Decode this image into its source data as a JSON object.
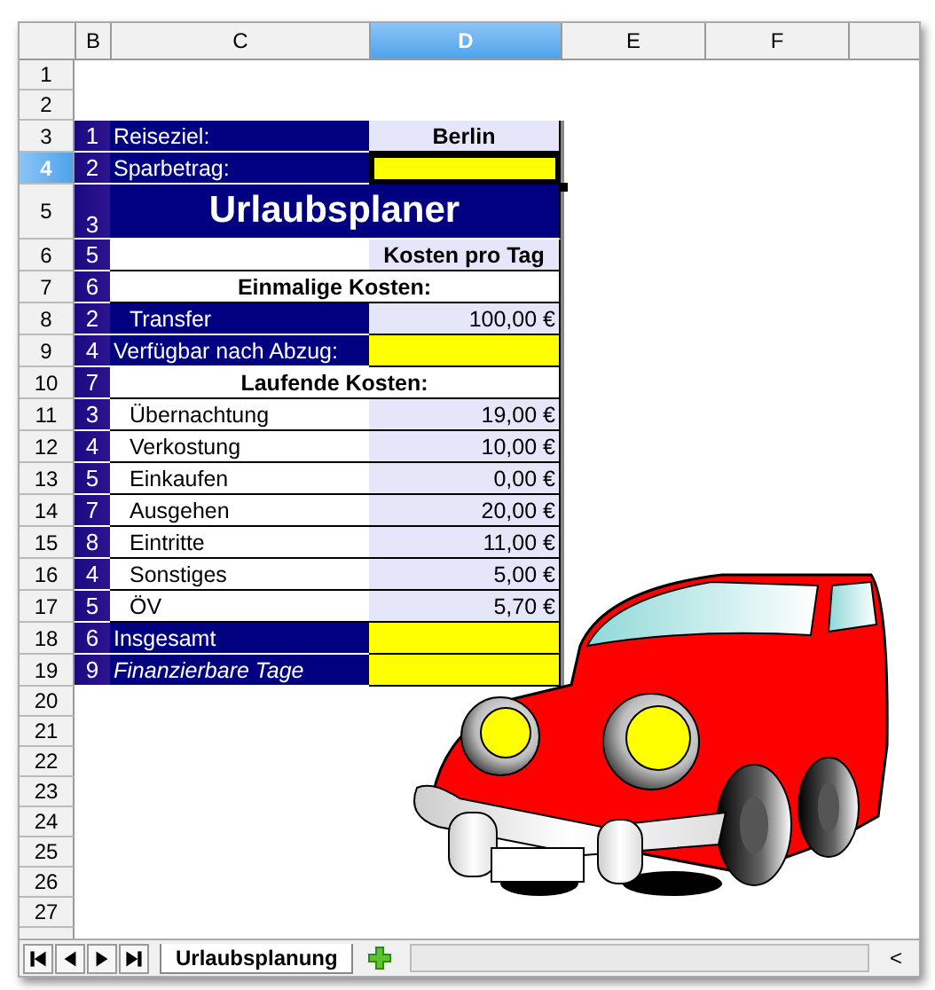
{
  "columns": [
    {
      "label": "B",
      "selected": false
    },
    {
      "label": "C",
      "selected": false
    },
    {
      "label": "D",
      "selected": true
    },
    {
      "label": "E",
      "selected": false
    },
    {
      "label": "F",
      "selected": false
    }
  ],
  "rows": [
    {
      "header": "1",
      "selected": false
    },
    {
      "header": "2",
      "selected": false
    },
    {
      "header": "3",
      "selected": false,
      "kind": "field",
      "num": "1",
      "label": "Reiseziel:",
      "value": "Berlin"
    },
    {
      "header": "4",
      "selected": true,
      "kind": "input",
      "num": "2",
      "label": "Sparbetrag:",
      "cell_selected": true
    },
    {
      "header": "5",
      "selected": false,
      "kind": "title",
      "num": "3",
      "label": "Urlaubsplaner"
    },
    {
      "header": "6",
      "selected": false,
      "kind": "column-head",
      "num": "5",
      "value": "Kosten pro Tag"
    },
    {
      "header": "7",
      "selected": false,
      "kind": "section",
      "num": "6",
      "label": "Einmalige Kosten:"
    },
    {
      "header": "8",
      "selected": false,
      "kind": "fixed-cost",
      "num": "2",
      "label": "Transfer",
      "value": "100,00 €"
    },
    {
      "header": "9",
      "selected": false,
      "kind": "input",
      "num": "4",
      "label": "Verfügbar nach Abzug:",
      "cell_selected": false
    },
    {
      "header": "10",
      "selected": false,
      "kind": "section",
      "num": "7",
      "label": "Laufende Kosten:"
    },
    {
      "header": "11",
      "selected": false,
      "kind": "cost",
      "num": "3",
      "label": "Übernachtung",
      "value": "19,00 €"
    },
    {
      "header": "12",
      "selected": false,
      "kind": "cost",
      "num": "4",
      "label": "Verkostung",
      "value": "10,00 €"
    },
    {
      "header": "13",
      "selected": false,
      "kind": "cost",
      "num": "5",
      "label": "Einkaufen",
      "value": "0,00 €"
    },
    {
      "header": "14",
      "selected": false,
      "kind": "cost",
      "num": "7",
      "label": "Ausgehen",
      "value": "20,00 €"
    },
    {
      "header": "15",
      "selected": false,
      "kind": "cost",
      "num": "8",
      "label": "Eintritte",
      "value": "11,00 €"
    },
    {
      "header": "16",
      "selected": false,
      "kind": "cost",
      "num": "4",
      "label": "Sonstiges",
      "value": "5,00 €"
    },
    {
      "header": "17",
      "selected": false,
      "kind": "cost",
      "num": "5",
      "label": "ÖV",
      "value": "5,70 €"
    },
    {
      "header": "18",
      "selected": false,
      "kind": "input",
      "num": "6",
      "label": "Insgesamt",
      "cell_selected": false
    },
    {
      "header": "19",
      "selected": false,
      "kind": "input",
      "num": "9",
      "label": "Finanzierbare Tage",
      "cell_selected": false,
      "italic": true
    },
    {
      "header": "20",
      "selected": false
    },
    {
      "header": "21",
      "selected": false
    },
    {
      "header": "22",
      "selected": false
    },
    {
      "header": "23",
      "selected": false
    },
    {
      "header": "24",
      "selected": false
    },
    {
      "header": "25",
      "selected": false
    },
    {
      "header": "26",
      "selected": false
    },
    {
      "header": "27",
      "selected": false
    }
  ],
  "sheet_tabs": [
    {
      "label": "Urlaubsplanung",
      "selected": true
    }
  ],
  "scroll_button": "<"
}
